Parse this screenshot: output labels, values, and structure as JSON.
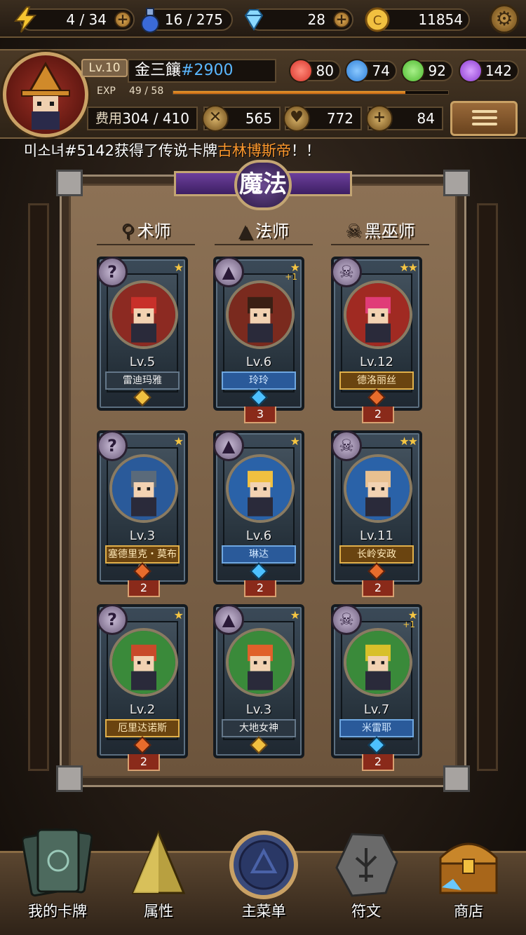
{
  "top_bar": {
    "energy": "4 / 34",
    "potion": "16 / 275",
    "gems": "28",
    "coins": "11854",
    "icons": {
      "energy": "lightning-icon",
      "potion": "potion-icon",
      "gems": "diamond-icon",
      "coins": "coin-icon",
      "settings": "gear-icon"
    }
  },
  "player": {
    "level": "Lv.10",
    "name": "金三饟",
    "tag": "#2900",
    "exp_label": "EXP",
    "exp_value": "49 / 58",
    "exp_fraction": 0.845,
    "orbs": [
      {
        "value": "80",
        "color": "#d8342a",
        "name": "red-orb-icon"
      },
      {
        "value": "74",
        "color": "#2e7fd8",
        "name": "blue-orb-icon"
      },
      {
        "value": "92",
        "color": "#4cb82e",
        "name": "green-orb-icon"
      },
      {
        "value": "142",
        "color": "#8b3ad0",
        "name": "purple-orb-icon"
      }
    ],
    "cost_label": "费用",
    "cost_value": "304 / 410",
    "attack": "565",
    "defense": "772",
    "health": "84"
  },
  "ticker": {
    "prefix": "미소녀#5142获得了传说卡牌",
    "highlight": "古林博斯帝",
    "suffix": "！！"
  },
  "board": {
    "title": "魔法",
    "columns": [
      {
        "label": "术师",
        "icon": "staff-icon"
      },
      {
        "label": "法师",
        "icon": "wizard-hat-icon"
      },
      {
        "label": "黑巫师",
        "icon": "skull-icon"
      }
    ],
    "cards": [
      {
        "level": "Lv.5",
        "name": "雷迪玛雅",
        "stars": "★",
        "bonus": "",
        "count": "",
        "badge": "?",
        "style": "plain",
        "hair": "#c8302a",
        "bg": "#8c2a22"
      },
      {
        "level": "Lv.6",
        "name": "玲玲",
        "stars": "★",
        "bonus": "+1",
        "count": "3",
        "badge": "▲",
        "style": "blue",
        "hair": "#3a1f14",
        "bg": "#7a2a1e"
      },
      {
        "level": "Lv.12",
        "name": "德洛丽丝",
        "stars": "★★",
        "bonus": "",
        "count": "2",
        "badge": "☠",
        "style": "gold",
        "hair": "#e03c78",
        "bg": "#a02a22"
      },
      {
        "level": "Lv.3",
        "name": "塞德里克・莫布雷",
        "stars": "★",
        "bonus": "",
        "count": "2",
        "badge": "?",
        "style": "gold",
        "hair": "#5a6a7a",
        "bg": "#2a5a9a"
      },
      {
        "level": "Lv.6",
        "name": "琳达",
        "stars": "★",
        "bonus": "",
        "count": "2",
        "badge": "▲",
        "style": "blue",
        "hair": "#f0c040",
        "bg": "#2a62a8"
      },
      {
        "level": "Lv.11",
        "name": "长岭安政",
        "stars": "★★",
        "bonus": "",
        "count": "2",
        "badge": "☠",
        "style": "gold",
        "hair": "#e8c090",
        "bg": "#2a62a8"
      },
      {
        "level": "Lv.2",
        "name": "厄里达诺斯",
        "stars": "★",
        "bonus": "",
        "count": "2",
        "badge": "?",
        "style": "gold",
        "hair": "#c84a2a",
        "bg": "#3a8a3a"
      },
      {
        "level": "Lv.3",
        "name": "大地女神",
        "stars": "★",
        "bonus": "",
        "count": "",
        "badge": "▲",
        "style": "plain",
        "hair": "#e0602a",
        "bg": "#3a8a3a"
      },
      {
        "level": "Lv.7",
        "name": "米雷耶",
        "stars": "★",
        "bonus": "+1",
        "count": "2",
        "badge": "☠",
        "style": "blue",
        "hair": "#d8c02a",
        "bg": "#3a8a3a"
      }
    ]
  },
  "nav": [
    {
      "label": "我的卡牌",
      "icon": "cards-icon"
    },
    {
      "label": "属性",
      "icon": "triangle-crystal-icon"
    },
    {
      "label": "主菜单",
      "icon": "emblem-icon"
    },
    {
      "label": "符文",
      "icon": "rune-stone-icon"
    },
    {
      "label": "商店",
      "icon": "treasure-chest-icon"
    }
  ]
}
